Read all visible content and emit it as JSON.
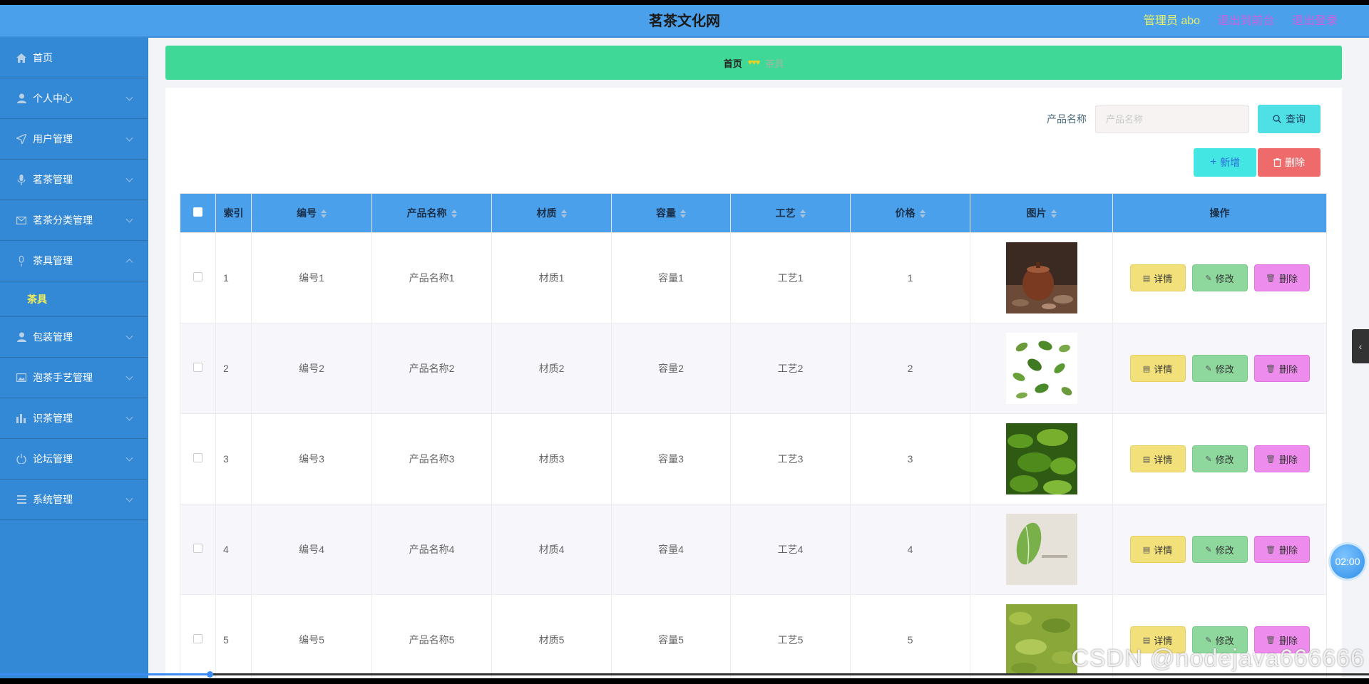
{
  "header": {
    "title": "茗茶文化网",
    "admin_label": "管理员 abo",
    "back_front_label": "退出到前台",
    "logout_label": "退出登录"
  },
  "sidebar": {
    "items": [
      {
        "label": "首页",
        "icon": "home-icon"
      },
      {
        "label": "个人中心",
        "icon": "user-icon"
      },
      {
        "label": "用户管理",
        "icon": "send-icon"
      },
      {
        "label": "茗茶管理",
        "icon": "microphone-icon"
      },
      {
        "label": "茗茶分类管理",
        "icon": "mail-icon"
      },
      {
        "label": "茶具管理",
        "icon": "mic-outline-icon"
      },
      {
        "label": "茶具",
        "icon": ""
      },
      {
        "label": "包装管理",
        "icon": "user-icon"
      },
      {
        "label": "泡茶手艺管理",
        "icon": "picture-icon"
      },
      {
        "label": "识茶管理",
        "icon": "chart-icon"
      },
      {
        "label": "论坛管理",
        "icon": "power-icon"
      },
      {
        "label": "系统管理",
        "icon": "list-icon"
      }
    ]
  },
  "breadcrumb": {
    "home": "首页",
    "separator": "♥♥♥",
    "current": "茶具"
  },
  "search": {
    "label": "产品名称",
    "placeholder": "产品名称",
    "query_label": "查询"
  },
  "actions": {
    "add_label": "新增",
    "delete_label": "删除"
  },
  "table": {
    "headers": [
      "索引",
      "编号",
      "产品名称",
      "材质",
      "容量",
      "工艺",
      "价格",
      "图片",
      "操作"
    ],
    "rows": [
      {
        "index": "1",
        "code": "编号1",
        "name": "产品名称1",
        "material": "材质1",
        "capacity": "容量1",
        "craft": "工艺1",
        "price": "1"
      },
      {
        "index": "2",
        "code": "编号2",
        "name": "产品名称2",
        "material": "材质2",
        "capacity": "容量2",
        "craft": "工艺2",
        "price": "2"
      },
      {
        "index": "3",
        "code": "编号3",
        "name": "产品名称3",
        "material": "材质3",
        "capacity": "容量3",
        "craft": "工艺3",
        "price": "3"
      },
      {
        "index": "4",
        "code": "编号4",
        "name": "产品名称4",
        "material": "材质4",
        "capacity": "容量4",
        "craft": "工艺4",
        "price": "4"
      },
      {
        "index": "5",
        "code": "编号5",
        "name": "产品名称5",
        "material": "材质5",
        "capacity": "容量5",
        "craft": "工艺5",
        "price": "5"
      }
    ],
    "row_actions": {
      "detail": "详情",
      "edit": "修改",
      "delete": "删除"
    }
  },
  "overlay": {
    "timer": "02:00",
    "watermark": "CSDN @nodejava666666"
  },
  "colors": {
    "header": "#4aa0ea",
    "sidebar": "#3489d6",
    "breadcrumb": "#3fd896",
    "table_header": "#4aa0ea"
  }
}
